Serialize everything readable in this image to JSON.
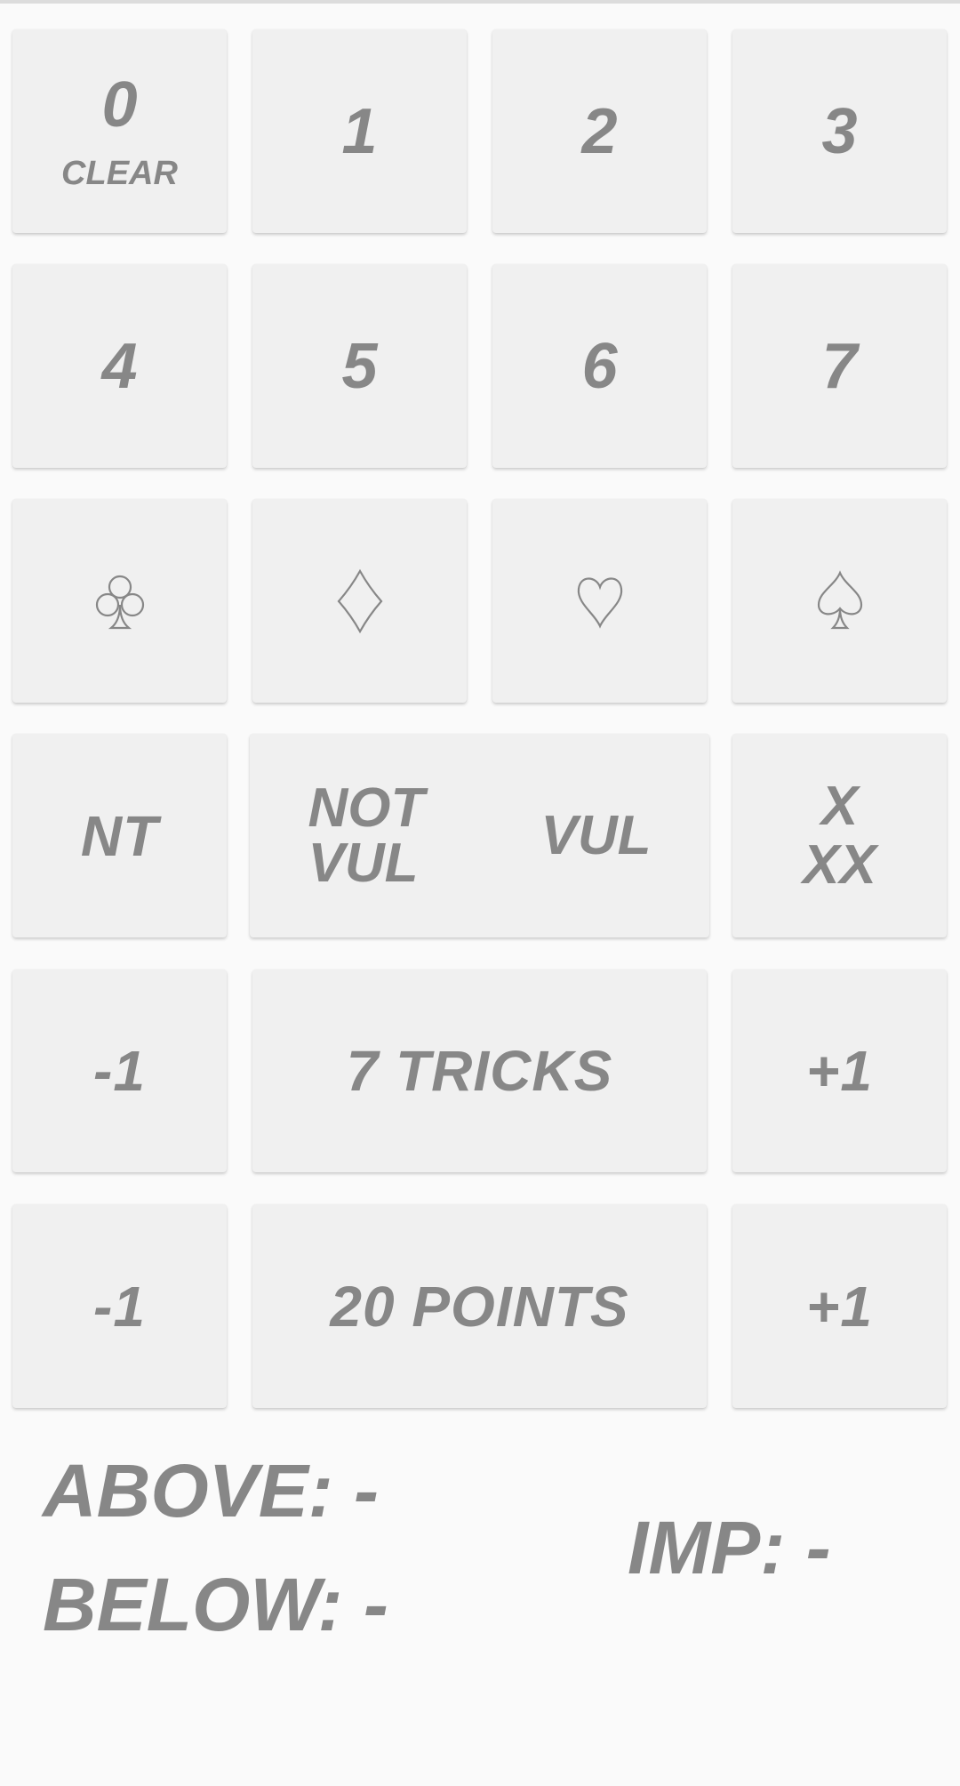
{
  "number_buttons": [
    {
      "label": "0",
      "sub": "CLEAR"
    },
    {
      "label": "1"
    },
    {
      "label": "2"
    },
    {
      "label": "3"
    },
    {
      "label": "4"
    },
    {
      "label": "5"
    },
    {
      "label": "6"
    },
    {
      "label": "7"
    }
  ],
  "suits": [
    {
      "icon": "club-icon"
    },
    {
      "icon": "diamond-icon"
    },
    {
      "icon": "heart-icon"
    },
    {
      "icon": "spade-icon"
    }
  ],
  "nt_label": "NT",
  "vulnerability": {
    "not_vul_line1": "NOT",
    "not_vul_line2": "VUL",
    "vul": "VUL"
  },
  "double": {
    "x": "X",
    "xx": "XX"
  },
  "tricks": {
    "minus": "-1",
    "label": "7 TRICKS",
    "plus": "+1"
  },
  "points": {
    "minus": "-1",
    "label": "20 POINTS",
    "plus": "+1"
  },
  "score": {
    "above": "ABOVE: -",
    "below": "BELOW: -",
    "imp": "IMP: -"
  },
  "colors": {
    "text": "#878787",
    "button": "#f0f0f0",
    "background": "#fafafa"
  }
}
